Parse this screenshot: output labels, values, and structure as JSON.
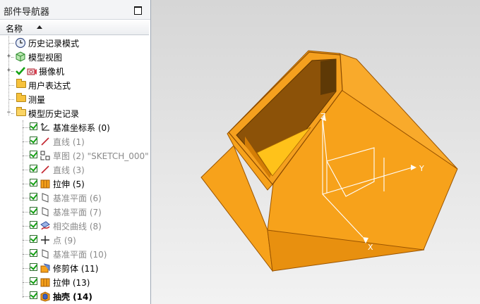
{
  "navigator": {
    "title": "部件导航器",
    "column_header": "名称",
    "items": [
      {
        "label": "历史记录模式",
        "icon": "clock-icon",
        "style": "normal",
        "kind": "node"
      },
      {
        "label": "模型视图",
        "icon": "model-view-icon",
        "style": "normal",
        "kind": "expandable"
      },
      {
        "label": "摄像机",
        "icon": "camera-icon",
        "style": "normal",
        "kind": "expandable"
      },
      {
        "label": "用户表达式",
        "icon": "folder-icon",
        "style": "normal",
        "kind": "node"
      },
      {
        "label": "测量",
        "icon": "folder-icon",
        "style": "normal",
        "kind": "node"
      },
      {
        "label": "模型历史记录",
        "icon": "folder-open-icon",
        "style": "normal",
        "kind": "expanded"
      },
      {
        "label": "基准坐标系 (0)",
        "icon": "datum-csys-icon",
        "style": "normal",
        "checked": true
      },
      {
        "label": "直线 (1)",
        "icon": "line-icon",
        "style": "gray",
        "checked": true
      },
      {
        "label": "草图 (2) \"SKETCH_000\"",
        "icon": "sketch-icon",
        "style": "gray",
        "checked": true
      },
      {
        "label": "直线 (3)",
        "icon": "line-icon",
        "style": "gray",
        "checked": true
      },
      {
        "label": "拉伸 (5)",
        "icon": "extrude-icon",
        "style": "normal",
        "checked": true
      },
      {
        "label": "基准平面 (6)",
        "icon": "datum-plane-icon",
        "style": "gray",
        "checked": true
      },
      {
        "label": "基准平面 (7)",
        "icon": "datum-plane-icon",
        "style": "gray",
        "checked": true
      },
      {
        "label": "相交曲线 (8)",
        "icon": "intersection-curve-icon",
        "style": "gray",
        "checked": true
      },
      {
        "label": "点 (9)",
        "icon": "point-icon",
        "style": "gray",
        "checked": true
      },
      {
        "label": "基准平面 (10)",
        "icon": "datum-plane-icon",
        "style": "gray",
        "checked": true
      },
      {
        "label": "修剪体 (11)",
        "icon": "trim-body-icon",
        "style": "normal",
        "checked": true
      },
      {
        "label": "拉伸 (13)",
        "icon": "extrude-icon",
        "style": "normal",
        "checked": true
      },
      {
        "label": "抽壳 (14)",
        "icon": "shell-icon",
        "style": "bold",
        "checked": true
      }
    ]
  },
  "viewport": {
    "axis_labels": {
      "z": "Z",
      "y": "Y",
      "x": "X"
    },
    "colors": {
      "body": "#f7a21b",
      "body_dark": "#c96f05",
      "inner": "#a8690d",
      "axis": "#ffffff"
    }
  }
}
